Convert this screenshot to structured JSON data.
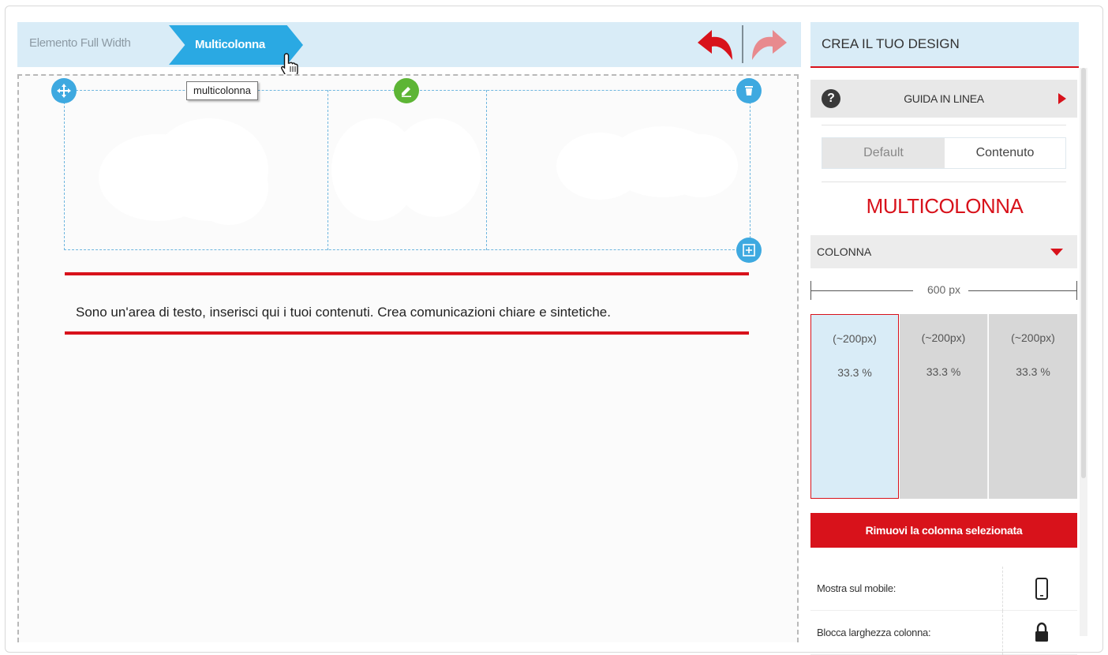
{
  "breadcrumb": {
    "items": [
      "Elemento Full Width",
      "Multicolonna"
    ]
  },
  "canvas": {
    "tooltip": "multicolonna",
    "text": "Sono un'area di testo, inserisci qui i tuoi contenuti. Crea comunicazioni chiare e sintetiche."
  },
  "panel": {
    "title": "CREA IL TUO DESIGN",
    "guide_label": "GUIDA IN LINEA",
    "guide_icon": "?",
    "tabs": [
      "Default",
      "Contenuto"
    ],
    "selected_tab": "Contenuto",
    "section_title": "MULTICOLONNA",
    "column_header": "COLONNA",
    "ruler_label": "600 px",
    "columns": [
      {
        "width": "(~200px)",
        "percent": "33.3 %",
        "selected": true
      },
      {
        "width": "(~200px)",
        "percent": "33.3 %",
        "selected": false
      },
      {
        "width": "(~200px)",
        "percent": "33.3 %",
        "selected": false
      }
    ],
    "remove_button": "Rimuovi la colonna selezionata",
    "options": [
      {
        "label": "Mostra sul mobile:",
        "icon": "mobile-phone-icon"
      },
      {
        "label": "Blocca larghezza colonna:",
        "icon": "padlock-icon"
      }
    ]
  },
  "colors": {
    "accent": "#d8121b",
    "primary": "#2aa9e3",
    "bar_bg": "#d9ecf7",
    "edit": "#5db535"
  }
}
